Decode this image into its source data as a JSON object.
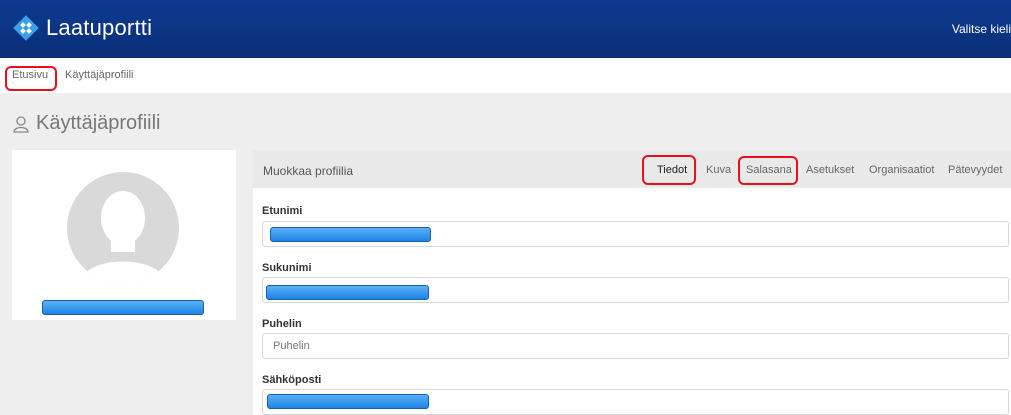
{
  "header": {
    "app_name": "Laatuportti",
    "language_label": "Valitse kieli"
  },
  "breadcrumb": {
    "items": [
      "Etusivu",
      "Käyttäjäprofiili"
    ]
  },
  "page": {
    "title": "Käyttäjäprofiili"
  },
  "profile_panel": {
    "title": "Muokkaa profiilia",
    "tabs": [
      "Tiedot",
      "Kuva",
      "Salasana",
      "Asetukset",
      "Organisaatiot",
      "Pätevyydet"
    ],
    "active_tab": "Tiedot"
  },
  "form": {
    "fields": [
      {
        "label": "Etunimi",
        "value": "",
        "placeholder": ""
      },
      {
        "label": "Sukunimi",
        "value": "",
        "placeholder": ""
      },
      {
        "label": "Puhelin",
        "value": "",
        "placeholder": "Puhelin"
      },
      {
        "label": "Sähköposti",
        "value": "",
        "placeholder": ""
      }
    ]
  },
  "colors": {
    "header_bg": "#0d3a8f",
    "highlight": "#e8101a",
    "redaction": "#2a8ff0"
  },
  "icons": {
    "logo": "diamond-logo-icon",
    "page_title": "user-outline-icon",
    "avatar": "person-silhouette-icon"
  }
}
